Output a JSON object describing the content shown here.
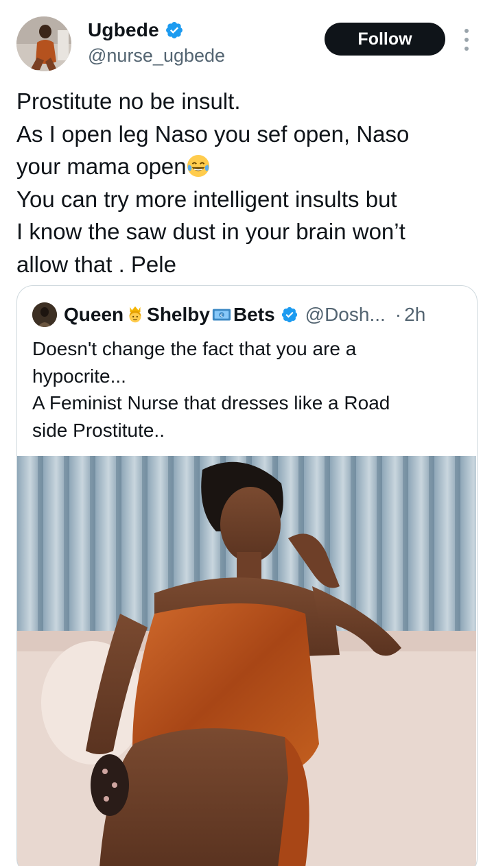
{
  "author": {
    "name": "Ugbede",
    "handle": "@nurse_ugbede",
    "verified": true,
    "avatar_icon": "profile-photo"
  },
  "follow_button": {
    "label": "Follow"
  },
  "more_menu": {
    "icon": "more-vertical-icon"
  },
  "tweet": {
    "lines": [
      "Prostitute no be insult.",
      "As I open leg Naso you sef open, Naso",
      "your mama open",
      "You can try more intelligent insults but",
      "I know the saw dust in your brain won’t",
      "allow that . Pele"
    ],
    "emoji": "face-with-tears-of-joy"
  },
  "quoted_tweet": {
    "name_part1": "Queen",
    "name_part2": "Shelby",
    "name_part3": "Bets",
    "name_emojis": [
      "crowned-person-emoji",
      "euro-banknote-emoji"
    ],
    "handle": "@Dosh...",
    "separator": "·",
    "time": "2h",
    "verified": true,
    "lines": [
      "Doesn't change the fact that you are a",
      "hypocrite...",
      "A Feminist Nurse that dresses like a Road",
      "side Prostitute.."
    ],
    "media": "photo-woman-in-orange-satin-dress"
  },
  "colors": {
    "text_primary": "#0f1419",
    "text_secondary": "#536471",
    "verified_blue": "#1d9bf0",
    "follow_bg": "#0f1419",
    "border": "#cfd9de"
  }
}
